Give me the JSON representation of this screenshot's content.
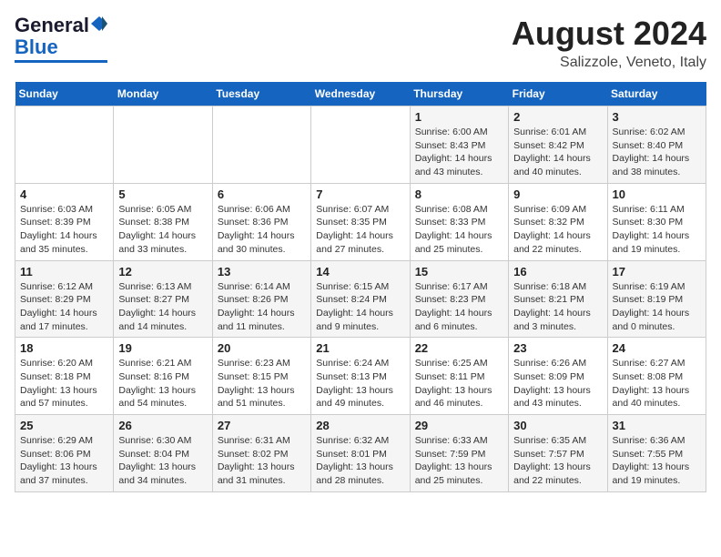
{
  "header": {
    "logo_line1": "General",
    "logo_line2": "Blue",
    "main_title": "August 2024",
    "subtitle": "Salizzole, Veneto, Italy"
  },
  "days_of_week": [
    "Sunday",
    "Monday",
    "Tuesday",
    "Wednesday",
    "Thursday",
    "Friday",
    "Saturday"
  ],
  "weeks": [
    [
      {
        "day": "",
        "info": ""
      },
      {
        "day": "",
        "info": ""
      },
      {
        "day": "",
        "info": ""
      },
      {
        "day": "",
        "info": ""
      },
      {
        "day": "1",
        "info": "Sunrise: 6:00 AM\nSunset: 8:43 PM\nDaylight: 14 hours\nand 43 minutes."
      },
      {
        "day": "2",
        "info": "Sunrise: 6:01 AM\nSunset: 8:42 PM\nDaylight: 14 hours\nand 40 minutes."
      },
      {
        "day": "3",
        "info": "Sunrise: 6:02 AM\nSunset: 8:40 PM\nDaylight: 14 hours\nand 38 minutes."
      }
    ],
    [
      {
        "day": "4",
        "info": "Sunrise: 6:03 AM\nSunset: 8:39 PM\nDaylight: 14 hours\nand 35 minutes."
      },
      {
        "day": "5",
        "info": "Sunrise: 6:05 AM\nSunset: 8:38 PM\nDaylight: 14 hours\nand 33 minutes."
      },
      {
        "day": "6",
        "info": "Sunrise: 6:06 AM\nSunset: 8:36 PM\nDaylight: 14 hours\nand 30 minutes."
      },
      {
        "day": "7",
        "info": "Sunrise: 6:07 AM\nSunset: 8:35 PM\nDaylight: 14 hours\nand 27 minutes."
      },
      {
        "day": "8",
        "info": "Sunrise: 6:08 AM\nSunset: 8:33 PM\nDaylight: 14 hours\nand 25 minutes."
      },
      {
        "day": "9",
        "info": "Sunrise: 6:09 AM\nSunset: 8:32 PM\nDaylight: 14 hours\nand 22 minutes."
      },
      {
        "day": "10",
        "info": "Sunrise: 6:11 AM\nSunset: 8:30 PM\nDaylight: 14 hours\nand 19 minutes."
      }
    ],
    [
      {
        "day": "11",
        "info": "Sunrise: 6:12 AM\nSunset: 8:29 PM\nDaylight: 14 hours\nand 17 minutes."
      },
      {
        "day": "12",
        "info": "Sunrise: 6:13 AM\nSunset: 8:27 PM\nDaylight: 14 hours\nand 14 minutes."
      },
      {
        "day": "13",
        "info": "Sunrise: 6:14 AM\nSunset: 8:26 PM\nDaylight: 14 hours\nand 11 minutes."
      },
      {
        "day": "14",
        "info": "Sunrise: 6:15 AM\nSunset: 8:24 PM\nDaylight: 14 hours\nand 9 minutes."
      },
      {
        "day": "15",
        "info": "Sunrise: 6:17 AM\nSunset: 8:23 PM\nDaylight: 14 hours\nand 6 minutes."
      },
      {
        "day": "16",
        "info": "Sunrise: 6:18 AM\nSunset: 8:21 PM\nDaylight: 14 hours\nand 3 minutes."
      },
      {
        "day": "17",
        "info": "Sunrise: 6:19 AM\nSunset: 8:19 PM\nDaylight: 14 hours\nand 0 minutes."
      }
    ],
    [
      {
        "day": "18",
        "info": "Sunrise: 6:20 AM\nSunset: 8:18 PM\nDaylight: 13 hours\nand 57 minutes."
      },
      {
        "day": "19",
        "info": "Sunrise: 6:21 AM\nSunset: 8:16 PM\nDaylight: 13 hours\nand 54 minutes."
      },
      {
        "day": "20",
        "info": "Sunrise: 6:23 AM\nSunset: 8:15 PM\nDaylight: 13 hours\nand 51 minutes."
      },
      {
        "day": "21",
        "info": "Sunrise: 6:24 AM\nSunset: 8:13 PM\nDaylight: 13 hours\nand 49 minutes."
      },
      {
        "day": "22",
        "info": "Sunrise: 6:25 AM\nSunset: 8:11 PM\nDaylight: 13 hours\nand 46 minutes."
      },
      {
        "day": "23",
        "info": "Sunrise: 6:26 AM\nSunset: 8:09 PM\nDaylight: 13 hours\nand 43 minutes."
      },
      {
        "day": "24",
        "info": "Sunrise: 6:27 AM\nSunset: 8:08 PM\nDaylight: 13 hours\nand 40 minutes."
      }
    ],
    [
      {
        "day": "25",
        "info": "Sunrise: 6:29 AM\nSunset: 8:06 PM\nDaylight: 13 hours\nand 37 minutes."
      },
      {
        "day": "26",
        "info": "Sunrise: 6:30 AM\nSunset: 8:04 PM\nDaylight: 13 hours\nand 34 minutes."
      },
      {
        "day": "27",
        "info": "Sunrise: 6:31 AM\nSunset: 8:02 PM\nDaylight: 13 hours\nand 31 minutes."
      },
      {
        "day": "28",
        "info": "Sunrise: 6:32 AM\nSunset: 8:01 PM\nDaylight: 13 hours\nand 28 minutes."
      },
      {
        "day": "29",
        "info": "Sunrise: 6:33 AM\nSunset: 7:59 PM\nDaylight: 13 hours\nand 25 minutes."
      },
      {
        "day": "30",
        "info": "Sunrise: 6:35 AM\nSunset: 7:57 PM\nDaylight: 13 hours\nand 22 minutes."
      },
      {
        "day": "31",
        "info": "Sunrise: 6:36 AM\nSunset: 7:55 PM\nDaylight: 13 hours\nand 19 minutes."
      }
    ]
  ]
}
